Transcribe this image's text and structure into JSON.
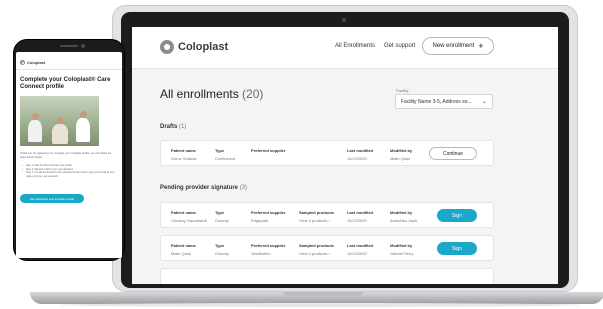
{
  "desktop": {
    "logo": "Coloplast",
    "nav": {
      "all_enrollments": "All Enrollments",
      "get_support": "Get support",
      "new_enrollment": "New enrollment",
      "plus_glyph": "+"
    },
    "page_title": "All enrollments",
    "page_count": "(20)",
    "facility": {
      "label": "Facility",
      "value": "Facility Name 3-5, Address so...",
      "chevron_glyph": "⌄"
    },
    "columns": {
      "patient": "Patient name",
      "type": "Type",
      "supplier": "Preferred supplier",
      "products": "Sampled products",
      "last_modified": "Last modified",
      "modified_by": "Modified by"
    },
    "drafts": {
      "title": "Drafts",
      "count": "(1)",
      "rows": [
        {
          "patient": "Dhruv Sultana",
          "type": "Continence",
          "supplier": "",
          "products": "",
          "last_modified": "11/12/2020",
          "modified_by": "Malin Quist",
          "action": "Continue"
        }
      ]
    },
    "pending": {
      "title": "Pending provider signature",
      "count": "(3)",
      "rows": [
        {
          "patient": "Christoy Gaudreault",
          "type": "Ostomy",
          "supplier": "Edgepark",
          "products": "View 3 products ›",
          "last_modified": "11/10/2020",
          "modified_by": "Amachtia Jopik",
          "action": "Sign"
        },
        {
          "patient": "Malin Quist",
          "type": "Ostomy",
          "supplier": "Vestibution",
          "products": "View 4 products ›",
          "last_modified": "11/10/2020",
          "modified_by": "Gabriel Perry",
          "action": "Sign"
        }
      ]
    }
  },
  "mobile": {
    "logo": "Coloplast",
    "title": "Complete your Coloplast® Care Connect profile",
    "intro": "Thank you for registering. To complete your Coloplast profile, you can follow the steps shown below.",
    "steps": [
      "Step 1: Click the link to activate your profile",
      "Step 2: Add and confirm your new password",
      "Step 3: You will be directed to the Coloplast Portal to log in using your email as user name and your new password"
    ],
    "cta": "Set password and activate profile"
  },
  "colors": {
    "accent": "#1aa7c9",
    "frame": "#1c1c1e",
    "page_bg": "#f4f4f5"
  }
}
